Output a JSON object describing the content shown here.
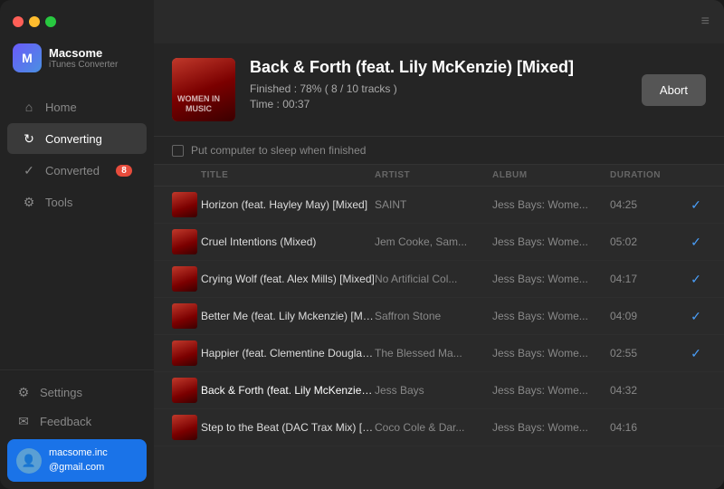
{
  "app": {
    "name": "Macsome",
    "subtitle": "iTunes Converter",
    "menu_icon": "≡"
  },
  "traffic_lights": {
    "red": "#ff5f57",
    "yellow": "#febc2e",
    "green": "#28c840"
  },
  "sidebar": {
    "nav_items": [
      {
        "id": "home",
        "label": "Home",
        "icon": "⌂",
        "active": false
      },
      {
        "id": "converting",
        "label": "Converting",
        "icon": "↻",
        "active": true
      },
      {
        "id": "converted",
        "label": "Converted",
        "icon": "✓",
        "active": false,
        "badge": "8"
      },
      {
        "id": "tools",
        "label": "Tools",
        "icon": "⚙",
        "active": false
      }
    ],
    "bottom_items": [
      {
        "id": "settings",
        "label": "Settings",
        "icon": "⚙"
      },
      {
        "id": "feedback",
        "label": "Feedback",
        "icon": "✉"
      }
    ],
    "user": {
      "email_line1": "macsome.inc",
      "email_line2": "@gmail.com"
    }
  },
  "header": {
    "album_title": "Back & Forth (feat. Lily McKenzie) [Mixed]",
    "progress_text": "Finished : 78% ( 8 / 10 tracks )",
    "time_text": "Time :  00:37",
    "abort_label": "Abort",
    "sleep_label": "Put computer to sleep when finished"
  },
  "columns": {
    "title": "TITLE",
    "artist": "ARTIST",
    "album": "ALBUM",
    "duration": "DURATION"
  },
  "tracks": [
    {
      "title": "Horizon (feat. Hayley May) [Mixed]",
      "artist": "SAINT",
      "album": "Jess Bays: Wome...",
      "duration": "04:25",
      "done": true,
      "converting": false
    },
    {
      "title": "Cruel Intentions (Mixed)",
      "artist": "Jem Cooke, Sam...",
      "album": "Jess Bays: Wome...",
      "duration": "05:02",
      "done": true,
      "converting": false
    },
    {
      "title": "Crying Wolf (feat. Alex Mills) [Mixed]",
      "artist": "No Artificial Col...",
      "album": "Jess Bays: Wome...",
      "duration": "04:17",
      "done": true,
      "converting": false
    },
    {
      "title": "Better Me (feat. Lily Mckenzie) [Mixed]",
      "artist": "Saffron Stone",
      "album": "Jess Bays: Wome...",
      "duration": "04:09",
      "done": true,
      "converting": false
    },
    {
      "title": "Happier (feat. Clementine Douglas) [..…",
      "artist": "The Blessed Ma...",
      "album": "Jess Bays: Wome...",
      "duration": "02:55",
      "done": true,
      "converting": false
    },
    {
      "title": "Back & Forth (feat. Lily McKenzie) [Mi...",
      "artist": "Jess Bays",
      "album": "Jess Bays: Wome...",
      "duration": "04:32",
      "done": false,
      "converting": true
    },
    {
      "title": "Step to the Beat (DAC Trax Mix) [Mixed]",
      "artist": "Coco Cole & Dar...",
      "album": "Jess Bays: Wome...",
      "duration": "04:16",
      "done": false,
      "converting": false
    }
  ]
}
